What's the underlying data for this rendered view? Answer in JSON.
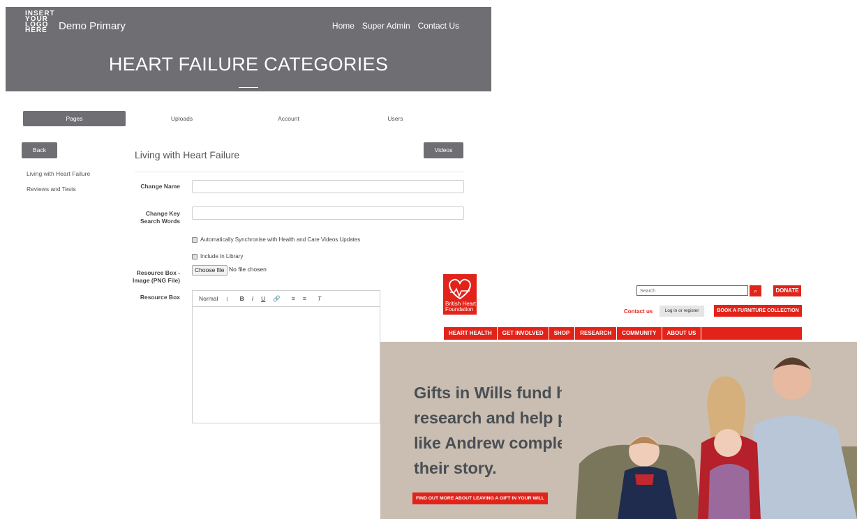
{
  "cms": {
    "logo_lines": [
      "INSERT",
      "YOUR",
      "LOGO",
      "HERE"
    ],
    "site_name": "Demo Primary",
    "nav": [
      "Home",
      "Super Admin",
      "Contact Us"
    ],
    "page_heading": "HEART FAILURE CATEGORIES",
    "tabs": [
      {
        "label": "Pages",
        "active": true
      },
      {
        "label": "Uploads",
        "active": false
      },
      {
        "label": "Account",
        "active": false
      },
      {
        "label": "Users",
        "active": false
      }
    ],
    "back_label": "Back",
    "side_links": [
      "Living with Heart Failure",
      "Reviews and Tests"
    ],
    "section_title": "Living with Heart Failure",
    "videos_label": "Videos",
    "form": {
      "change_name_label": "Change Name",
      "change_name_value": "",
      "key_words_label_1": "Change Key",
      "key_words_label_2": "Search Words",
      "key_words_value": "",
      "sync_label": "Automatically Synchronise with Health and Care Videos Updates",
      "sync_checked": true,
      "library_label": "Include In Library",
      "library_checked": true,
      "resource_image_label_1": "Resource Box -",
      "resource_image_label_2": "Image (PNG File)",
      "choose_file_label": "Choose file",
      "file_status": "No file chosen",
      "resource_box_label": "Resource Box",
      "editor_format": "Normal",
      "editor_format_arrow": "↕"
    }
  },
  "bhf": {
    "logo_text_1": "British Heart",
    "logo_text_2": "Foundation",
    "search_placeholder": "Search",
    "donate_label": "DONATE",
    "contact_label": "Contact us",
    "login_label": "Log in or register",
    "furniture_label": "BOOK A FURNITURE COLLECTION",
    "nav": [
      "HEART HEALTH",
      "GET INVOLVED",
      "SHOP",
      "RESEARCH",
      "COMMUNITY",
      "ABOUT US"
    ],
    "hero_lines": [
      "Gifts in Wills fund half our",
      "research and help people",
      "like Andrew complete",
      "their story."
    ],
    "cta_label": "FIND OUT MORE ABOUT LEAVING A GIFT IN YOUR WILL",
    "brand_color": "#e2231a"
  }
}
